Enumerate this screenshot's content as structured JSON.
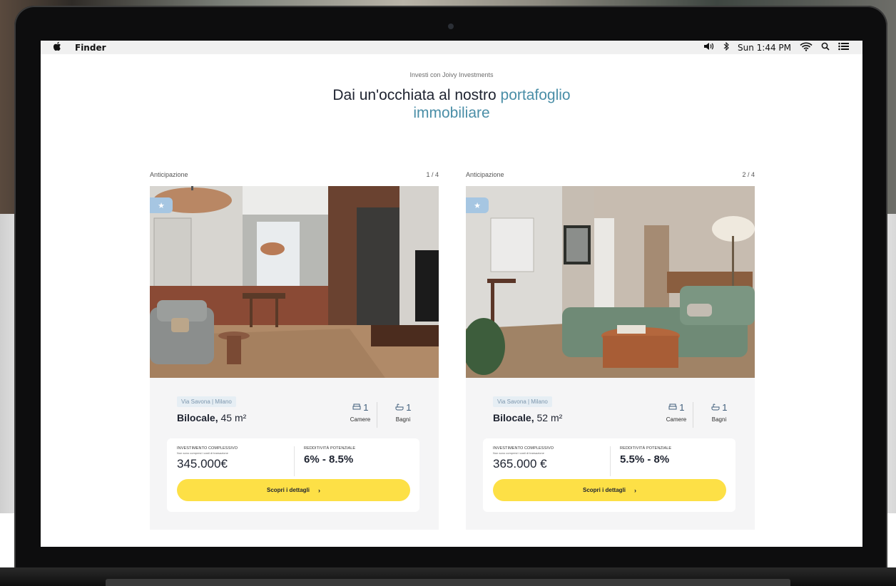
{
  "menubar": {
    "app_name": "Finder",
    "clock": "Sun 1:44 PM"
  },
  "hero": {
    "eyebrow": "Investi con Joivy Investments",
    "headline_main": "Dai un'occhiata al nostro ",
    "headline_accent_1": "portafoglio",
    "headline_accent_2": "immobiliare"
  },
  "cards": [
    {
      "tag": "Anticipazione",
      "counter": "1 / 4",
      "address": "Via Savona | Milano",
      "type": "Bilocale,",
      "size": " 45 m²",
      "rooms": "1",
      "rooms_label": "Camere",
      "baths": "1",
      "baths_label": "Bagni",
      "invest_label": "INVESTIMENTO COMPLESSIVO",
      "invest_note": "Non sono compresi i costi di transazione",
      "price": "345.000€",
      "yield_label": "REDDITIVITÀ POTENZIALE",
      "yield": "6% - 8.5%",
      "cta": "Scopri i dettagli"
    },
    {
      "tag": "Anticipazione",
      "counter": "2 / 4",
      "address": "Via Savona | Milano",
      "type": "Bilocale,",
      "size": " 52 m²",
      "rooms": "1",
      "rooms_label": "Camere",
      "baths": "1",
      "baths_label": "Bagni",
      "invest_label": "INVESTIMENTO COMPLESSIVO",
      "invest_note": "Non sono compresi i costi di transazione",
      "price": "365.000 €",
      "yield_label": "REDDITIVITÀ POTENZIALE",
      "yield": "5.5% - 8%",
      "cta": "Scopri i dettagli"
    }
  ],
  "icons": {
    "apple": "apple-logo-icon",
    "volume": "volume-icon",
    "bluetooth": "bluetooth-icon",
    "wifi": "wifi-icon",
    "spotlight": "search-icon",
    "menu": "list-icon",
    "bed": "bed-icon",
    "bath": "bathtub-icon",
    "star": "star-icon",
    "chevron": "chevron-right-icon"
  },
  "colors": {
    "accent": "#4a8ea7",
    "cta": "#fde046",
    "text": "#1e2330"
  }
}
